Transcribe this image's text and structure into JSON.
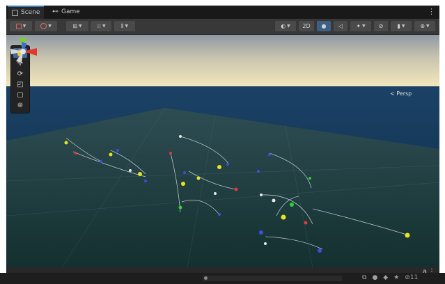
{
  "tabs": [
    {
      "label": "Scene",
      "icon": "scene-icon"
    },
    {
      "label": "Game",
      "icon": "gamepad-icon"
    }
  ],
  "toolbar": {
    "mode_2d_label": "2D"
  },
  "scene": {
    "projection_label": "< Persp",
    "tools": [
      "hand-tool-icon",
      "move-tool-icon",
      "rotate-tool-icon",
      "scale-tool-icon",
      "rect-tool-icon",
      "transform-tool-icon"
    ]
  },
  "footer": {
    "text_label": "a",
    "menu_label": "⋮"
  },
  "statusbar": {
    "hidden_count": "11"
  },
  "colors": {
    "accent": "#3a79bb",
    "ocean": "#0f3250",
    "ground": "#1f3b3d",
    "sky_horizon": "#f0e4b6"
  }
}
